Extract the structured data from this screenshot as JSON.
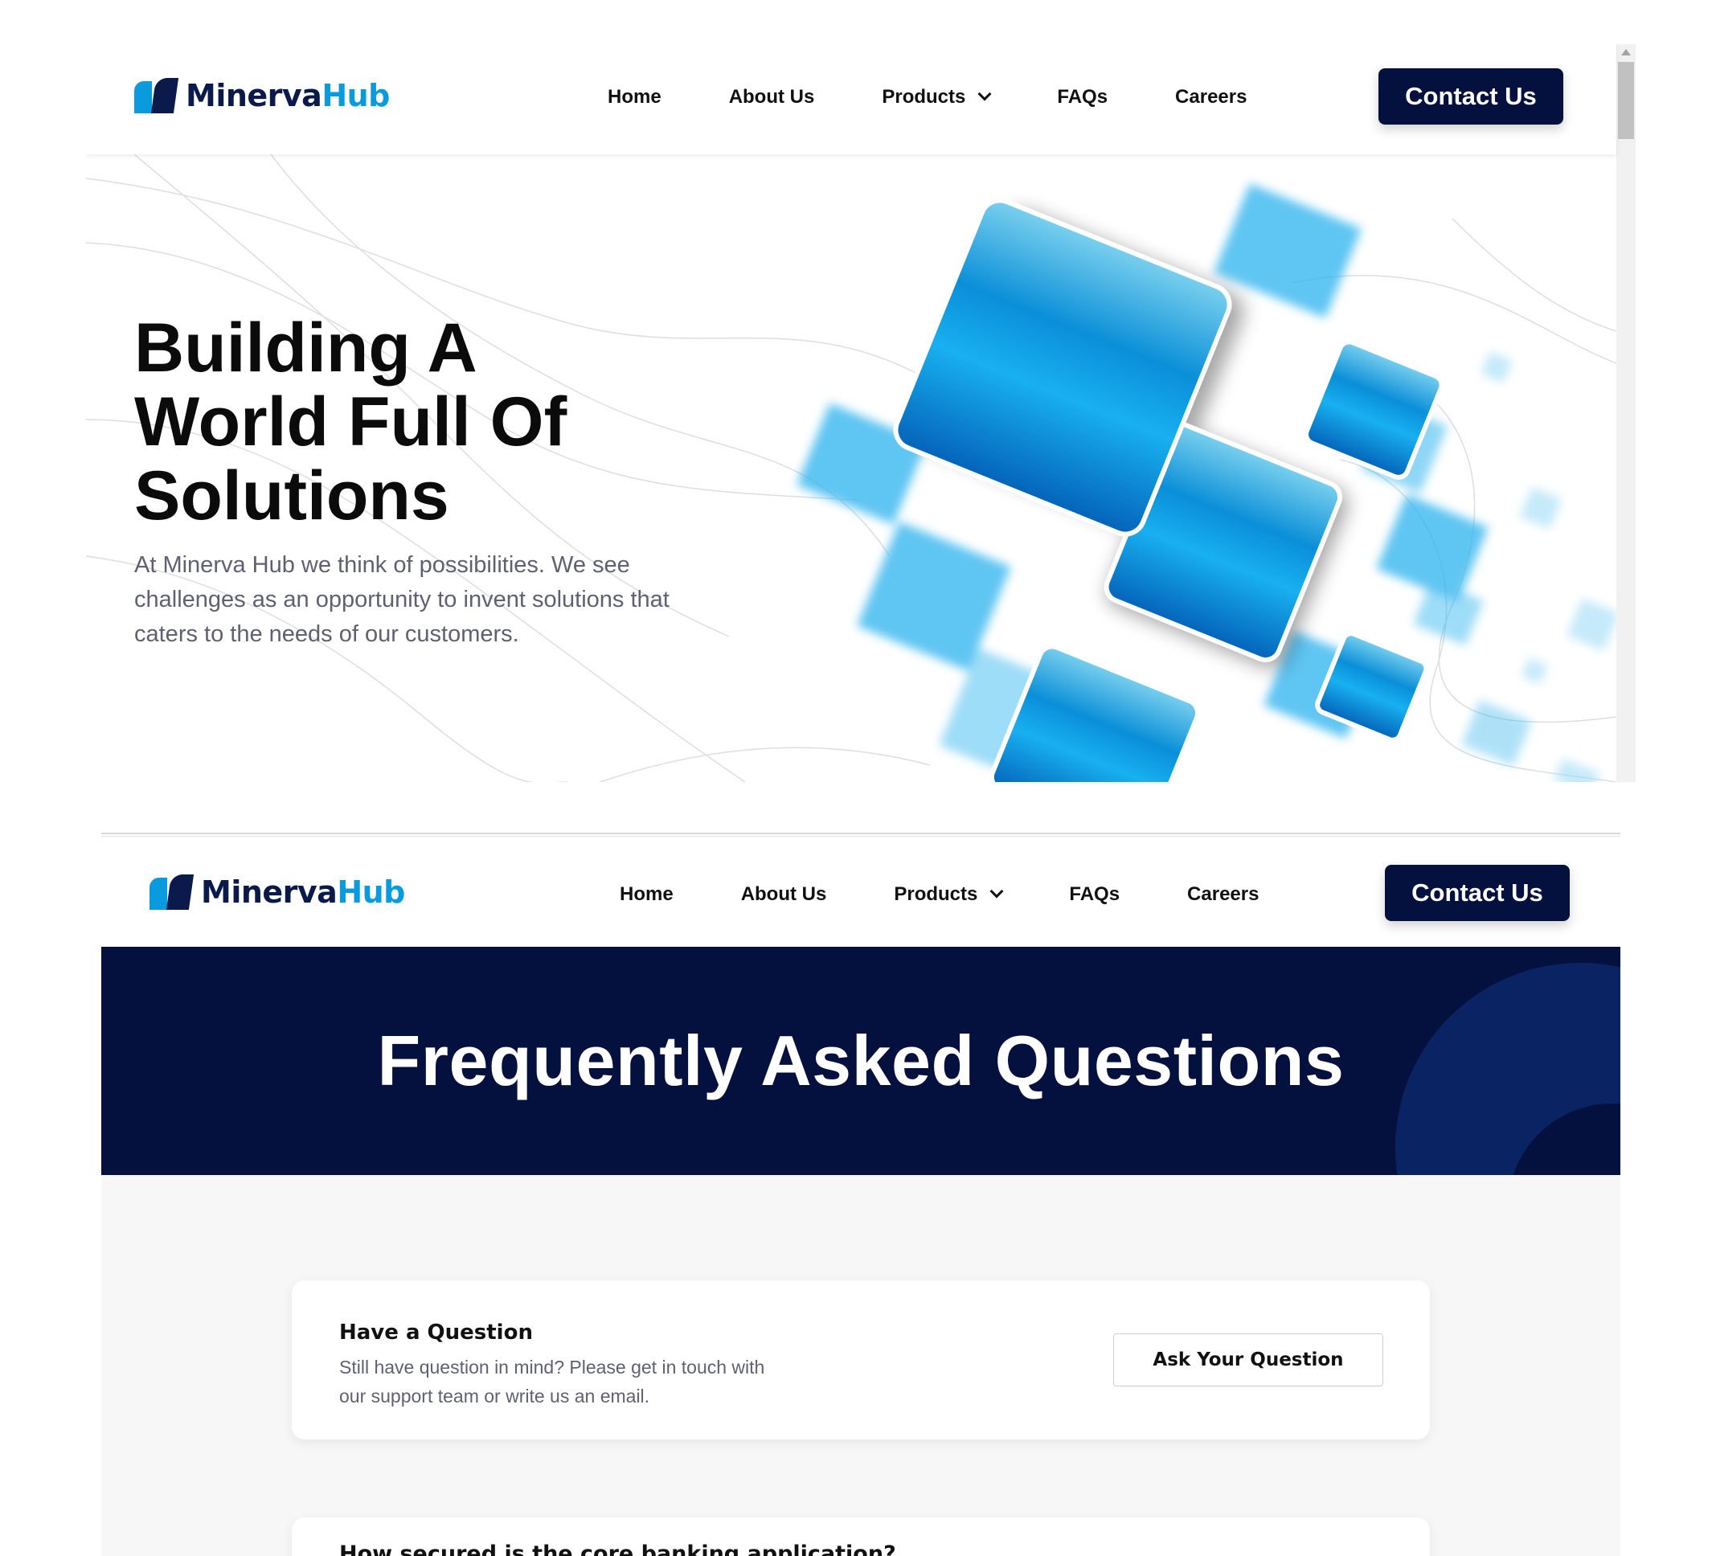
{
  "brand": {
    "name_part1": "Minerva",
    "name_part2": "Hub"
  },
  "nav": {
    "items": [
      {
        "label": "Home"
      },
      {
        "label": "About Us"
      },
      {
        "label": "Products",
        "has_dropdown": true
      },
      {
        "label": "FAQs"
      },
      {
        "label": "Careers"
      }
    ],
    "cta_label": "Contact Us"
  },
  "hero": {
    "title_lines": [
      "Building A",
      "World Full Of",
      "Solutions"
    ],
    "description": "At Minerva Hub we think of possibilities. We see challenges as an opportunity to invent solutions that caters to the needs of our customers."
  },
  "faq_page": {
    "banner_title": "Frequently Asked Questions",
    "question_card": {
      "title": "Have a Question",
      "description": "Still have question in mind? Please get in touch with our support team or write us an email.",
      "button_label": "Ask Your Question"
    },
    "faqs": [
      {
        "question": "How secured is the core banking application?",
        "expanded": true
      }
    ]
  },
  "colors": {
    "navy": "#04113f",
    "accent_blue": "#0a9bdf",
    "muted_text": "#5f6173"
  }
}
